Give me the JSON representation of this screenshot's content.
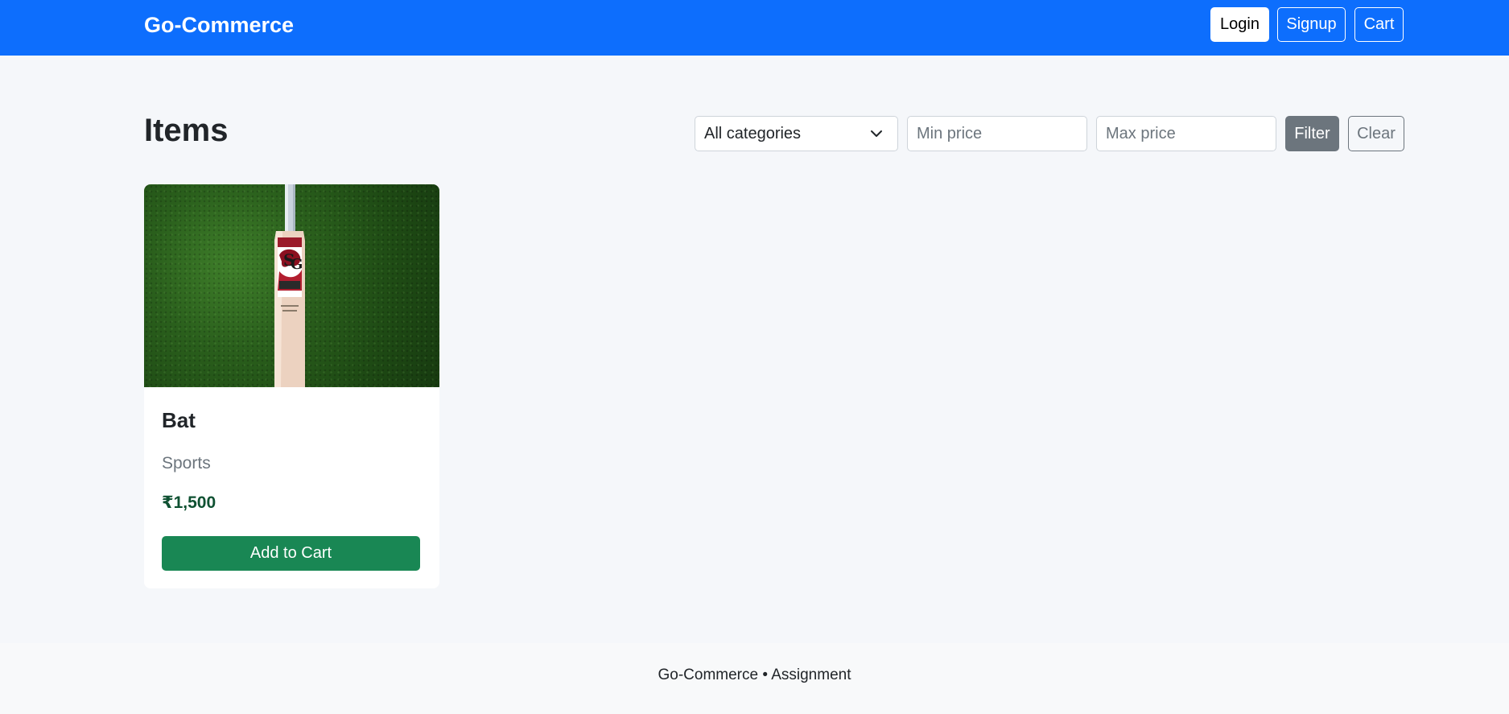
{
  "navbar": {
    "brand": "Go-Commerce",
    "login_label": "Login",
    "signup_label": "Signup",
    "cart_label": "Cart",
    "color": "#0d6efd"
  },
  "main": {
    "title": "Items",
    "filters": {
      "category_selected": "All categories",
      "min_placeholder": "Min price",
      "max_placeholder": "Max price",
      "filter_label": "Filter",
      "clear_label": "Clear"
    },
    "items": [
      {
        "name": "Bat",
        "category": "Sports",
        "price": "₹1,500",
        "button_label": "Add to Cart",
        "image": "cricket-bat-on-grass"
      }
    ]
  },
  "footer": {
    "text": "Go-Commerce • Assignment"
  },
  "icons": {
    "select_caret": "chevron-down-icon"
  }
}
